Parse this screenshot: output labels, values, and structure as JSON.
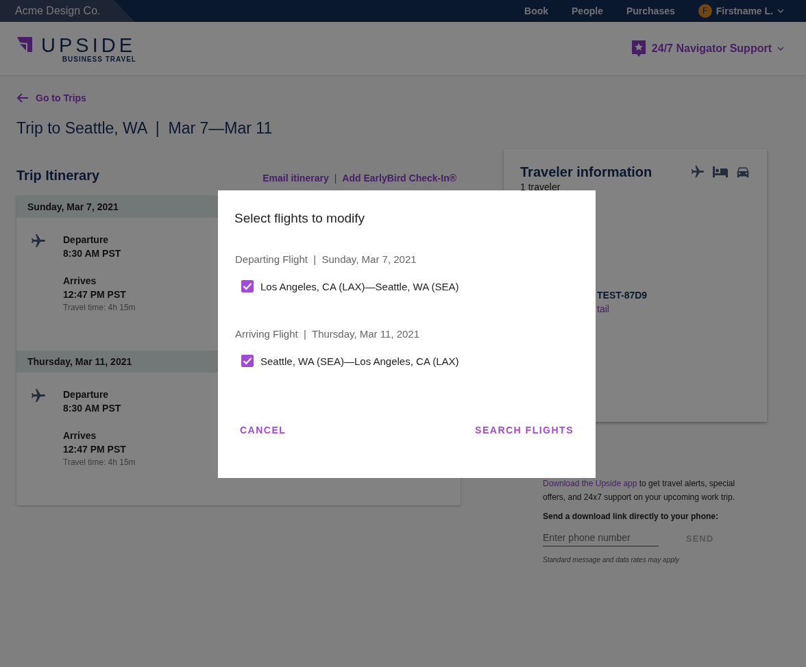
{
  "top_bar": {
    "company": "Acme Design Co.",
    "nav": [
      "Book",
      "People",
      "Purchases"
    ],
    "user": {
      "initial": "F",
      "name": "Firstname L."
    }
  },
  "header": {
    "logo_word": "UPSIDE",
    "logo_sub": "BUSINESS TRAVEL",
    "support": "24/7 Navigator Support"
  },
  "back_link": "Go to Trips",
  "trip_title": "Trip to Seattle, WA  |  Mar 7—Mar 11",
  "itinerary": {
    "title": "Trip Itinerary",
    "links": [
      "Email itinerary",
      "Add EarlyBird Check-In®"
    ],
    "link_separator": "|",
    "days": [
      {
        "date": "Sunday, Mar 7, 2021",
        "departure_label": "Departure",
        "departure_time": "8:30 AM PST",
        "arrival_label": "Arrives",
        "arrival_time": "12:47 PM PST",
        "travel_time": "Travel time: 4h 15m"
      },
      {
        "date": "Thursday, Mar 11, 2021",
        "departure_label": "Departure",
        "departure_time": "8:30 AM PST",
        "arrival_label": "Arrives",
        "arrival_time": "12:47 PM PST",
        "travel_time": "Travel time: 4h 15m"
      }
    ]
  },
  "traveler_card": {
    "title": "Traveler information",
    "count": "1 traveler",
    "lines": [
      {
        "text": "TEST-87D9",
        "kind": "text"
      },
      {
        "text": "tail",
        "kind": "link"
      }
    ]
  },
  "app_promo": {
    "link": "Download the Upside app",
    "text": " to get travel alerts, special offers, and 24x7 support on your upcoming work trip.",
    "prompt": "Send a download link directly to your phone:",
    "phone_placeholder": "Enter phone number",
    "send": "SEND",
    "send_disabled": true,
    "note": "Standard message and data rates may apply"
  },
  "dialog": {
    "title": "Select flights to modify",
    "flights": [
      {
        "heading": "Departing Flight  |  Sunday, Mar 7, 2021",
        "route": "Los Angeles, CA (LAX)—Seattle, WA (SEA)",
        "checked": true
      },
      {
        "heading": "Arriving Flight  |  Thursday, Mar 11, 2021",
        "route": "Seattle, WA (SEA)—Los Angeles, CA (LAX)",
        "checked": true
      }
    ],
    "buttons": [
      "CANCEL",
      "SEARCH FLIGHTS"
    ]
  }
}
